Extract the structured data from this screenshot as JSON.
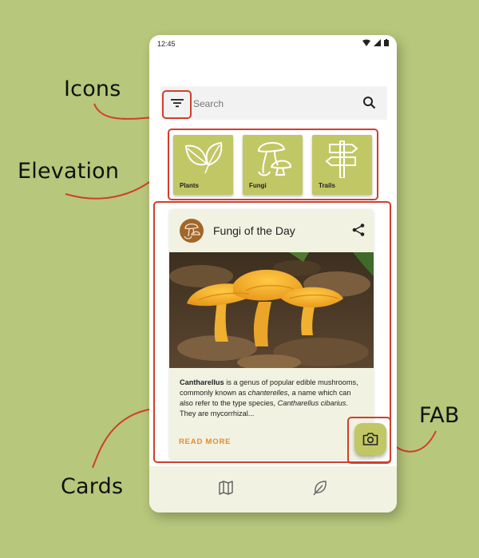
{
  "annotations": {
    "icons": "Icons",
    "elevation": "Elevation",
    "cards": "Cards",
    "fab": "FAB"
  },
  "status_bar": {
    "time": "12:45"
  },
  "search": {
    "placeholder": "Search"
  },
  "categories": [
    {
      "label": "Plants",
      "icon": "leaf-icon"
    },
    {
      "label": "Fungi",
      "icon": "mushroom-icon"
    },
    {
      "label": "Trails",
      "icon": "signpost-icon"
    }
  ],
  "card": {
    "title": "Fungi of the Day",
    "description_bold": "Cantharellus",
    "description_1": " is a genus of popular edible mushrooms, commonly known as ",
    "description_italic_1": "chanterelles",
    "description_2": ", a name which can also refer to the type species, ",
    "description_italic_2": "Cantharellus cibarius",
    "description_3": ". They are mycorrhizal...",
    "read_more": "READ MORE"
  },
  "colors": {
    "background": "#b7c77b",
    "accent": "#c2c765",
    "highlight": "#d23e2b",
    "link": "#e38a32",
    "avatar": "#a1662a"
  },
  "bottom_nav": {
    "items": [
      "map-icon",
      "leaf-icon"
    ]
  }
}
